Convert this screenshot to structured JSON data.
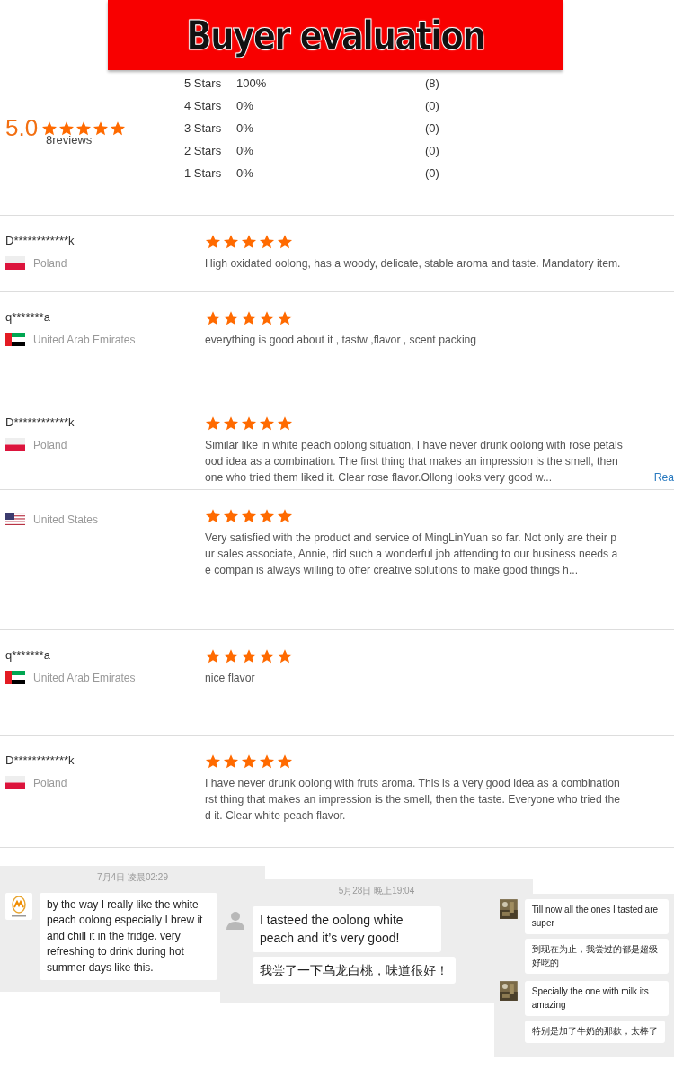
{
  "banner": {
    "title": "Buyer evaluation"
  },
  "summary": {
    "score": "5.0",
    "stars": 5,
    "reviews_text": "8reviews",
    "distribution": [
      {
        "label": "5 Stars",
        "percent": "100%",
        "count": "(8)"
      },
      {
        "label": "4 Stars",
        "percent": "0%",
        "count": "(0)"
      },
      {
        "label": "3 Stars",
        "percent": "0%",
        "count": "(0)"
      },
      {
        "label": "2 Stars",
        "percent": "0%",
        "count": "(0)"
      },
      {
        "label": "1 Stars",
        "percent": "0%",
        "count": "(0)"
      }
    ]
  },
  "reviews": [
    {
      "name": "D************k",
      "country": "Poland",
      "flag": {
        "kind": "poland"
      },
      "stars": 5,
      "lines": [
        "High oxidated oolong, has a woody, delicate, stable aroma and taste. Mandatory item."
      ]
    },
    {
      "name": "q*******a",
      "country": "United Arab Emirates",
      "flag": {
        "kind": "uae"
      },
      "stars": 5,
      "lines": [
        "everything is good about it , tastw ,flavor , scent  packing"
      ]
    },
    {
      "name": "D************k",
      "country": "Poland",
      "flag": {
        "kind": "poland"
      },
      "stars": 5,
      "lines": [
        "Similar like in white peach oolong situation, I have never drunk oolong with rose petals",
        "ood idea as a combination. The first thing that makes an impression is the smell, then",
        "one who tried them liked it. Clear rose flavor.Ollong looks very good w..."
      ],
      "link": "Rea"
    },
    {
      "country": "United States",
      "flag": {
        "kind": "usa"
      },
      "stars": 5,
      "lines": [
        "Very satisfied with the product and service of MingLinYuan so far. Not only are their p",
        "ur sales associate, Annie, did such a wonderful job attending to our business needs a",
        "e compan is always willing to offer creative solutions to make good things h..."
      ]
    },
    {
      "name": "q*******a",
      "country": "United Arab Emirates",
      "flag": {
        "kind": "uae"
      },
      "stars": 5,
      "lines": [
        "nice flavor"
      ]
    },
    {
      "name": "D************k",
      "country": "Poland",
      "flag": {
        "kind": "poland"
      },
      "stars": 5,
      "lines": [
        "I have never drunk oolong with fruts aroma. This is a very good idea as a combination",
        "rst thing that makes an impression is the smell, then the taste. Everyone who tried the",
        "d it. Clear white peach flavor."
      ]
    }
  ],
  "chats": [
    {
      "timestamp": "7月4日 凌晨02:29",
      "messages": [
        {
          "avatar": {
            "kind": "logo"
          },
          "text": "by the way I really like the white peach oolong especially I brew it and chill it in the fridge. very refreshing to drink during hot summer days like this."
        }
      ]
    },
    {
      "timestamp": "5月28日 晚上19:04",
      "messages": [
        {
          "avatar": {
            "kind": "person"
          },
          "text": "I tasteed the oolong white peach and it’s very good!",
          "translation": "我尝了一下乌龙白桃，味道很好！"
        }
      ]
    },
    {
      "messages": [
        {
          "text": "Till now all the ones I tasted are super",
          "translation": "到现在为止，我尝过的都是超级好吃的"
        },
        {
          "text": "Specially the one with milk its amazing",
          "translation": "特别是加了牛奶的那款，太棒了"
        }
      ]
    }
  ]
}
